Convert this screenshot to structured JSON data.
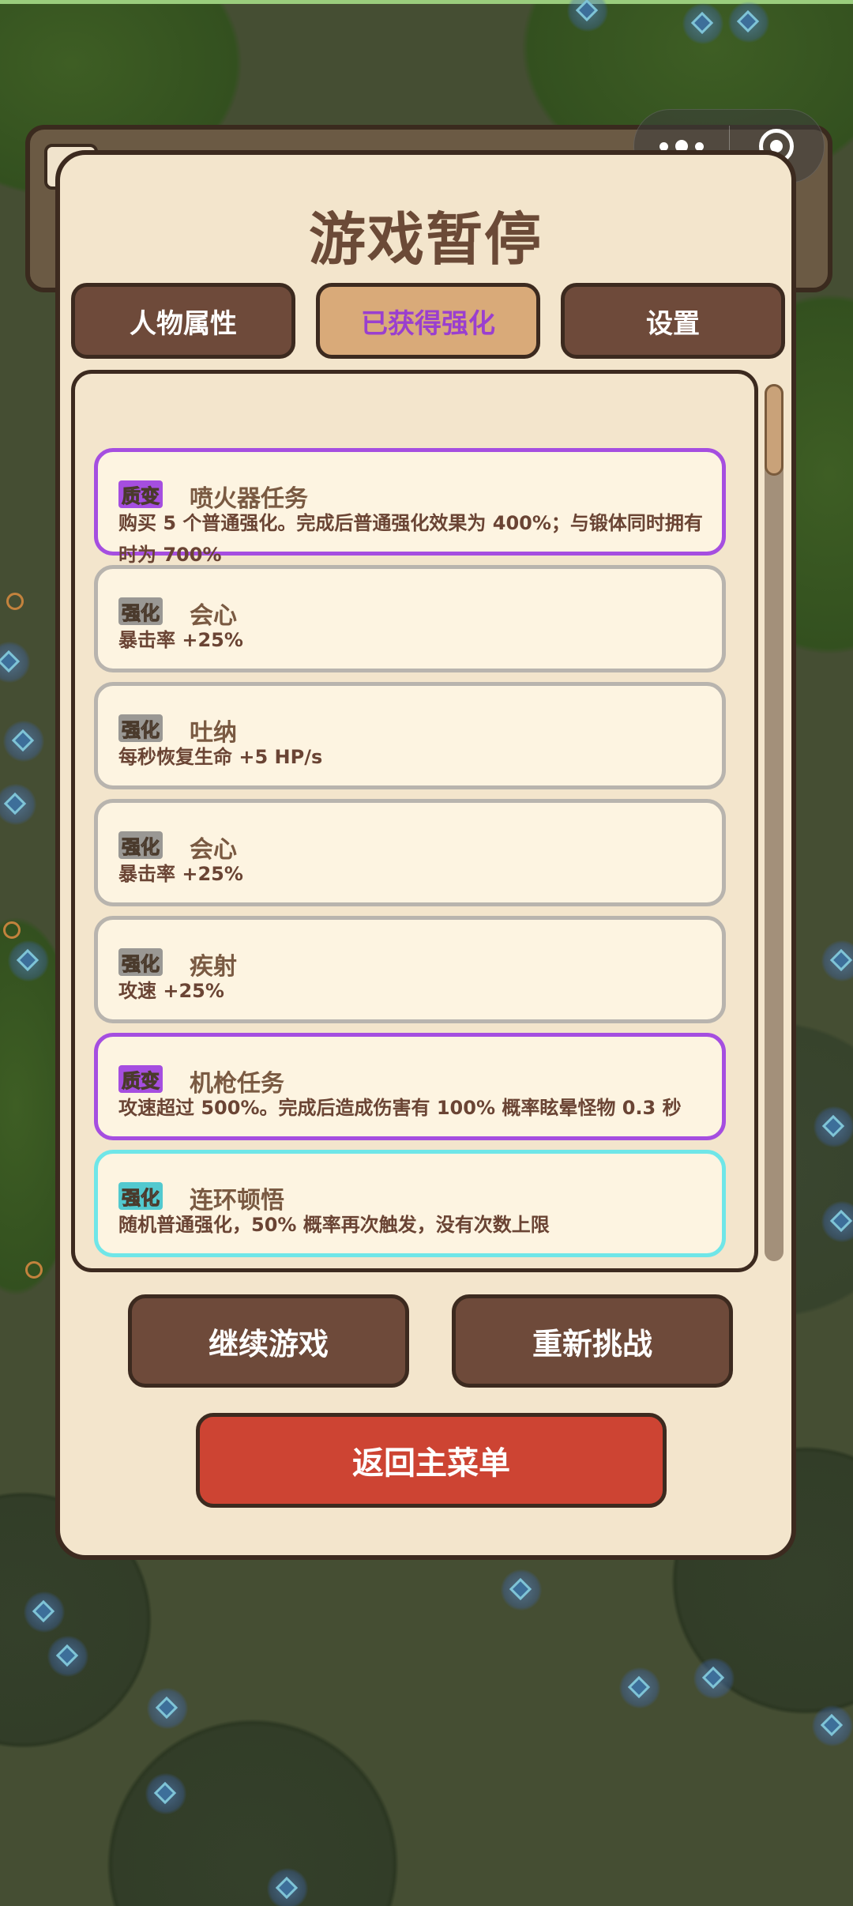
{
  "capsule": {
    "more_icon": "more-dots-icon",
    "close_icon": "target-close-icon"
  },
  "modal": {
    "title": "游戏暂停",
    "tabs": [
      {
        "label": "人物属性",
        "active": false
      },
      {
        "label": "已获得强化",
        "active": true
      },
      {
        "label": "设置",
        "active": false
      }
    ],
    "upgrades": [
      {
        "type": "质变",
        "name": "喷火器任务",
        "desc": "购买 5 个普通强化。完成后普通强化效果为 400%；与锻体同时拥有时为 700%",
        "rarity": "purple"
      },
      {
        "type": "强化",
        "name": "会心",
        "desc": "暴击率 +25%",
        "rarity": "gray"
      },
      {
        "type": "强化",
        "name": "吐纳",
        "desc": "每秒恢复生命 +5 HP/s",
        "rarity": "gray"
      },
      {
        "type": "强化",
        "name": "会心",
        "desc": "暴击率 +25%",
        "rarity": "gray"
      },
      {
        "type": "强化",
        "name": "疾射",
        "desc": "攻速 +25%",
        "rarity": "gray"
      },
      {
        "type": "质变",
        "name": "机枪任务",
        "desc": "攻速超过 500%。完成后造成伤害有 100% 概率眩晕怪物 0.3 秒",
        "rarity": "purple"
      },
      {
        "type": "强化",
        "name": "连环顿悟",
        "desc": "随机普通强化，50% 概率再次触发，没有次数上限",
        "rarity": "cyan"
      }
    ],
    "buttons": {
      "continue": "继续游戏",
      "retry": "重新挑战",
      "main_menu": "返回主菜单"
    }
  },
  "colors": {
    "panel": "#f3e5cc",
    "brown_button": "#6e4a3a",
    "active_tab": "#d9aa79",
    "red_button": "#cd4433",
    "purple_rarity": "#a54ee0",
    "cyan_rarity": "#6fe6e8",
    "gray_rarity": "#b8b4ae"
  }
}
